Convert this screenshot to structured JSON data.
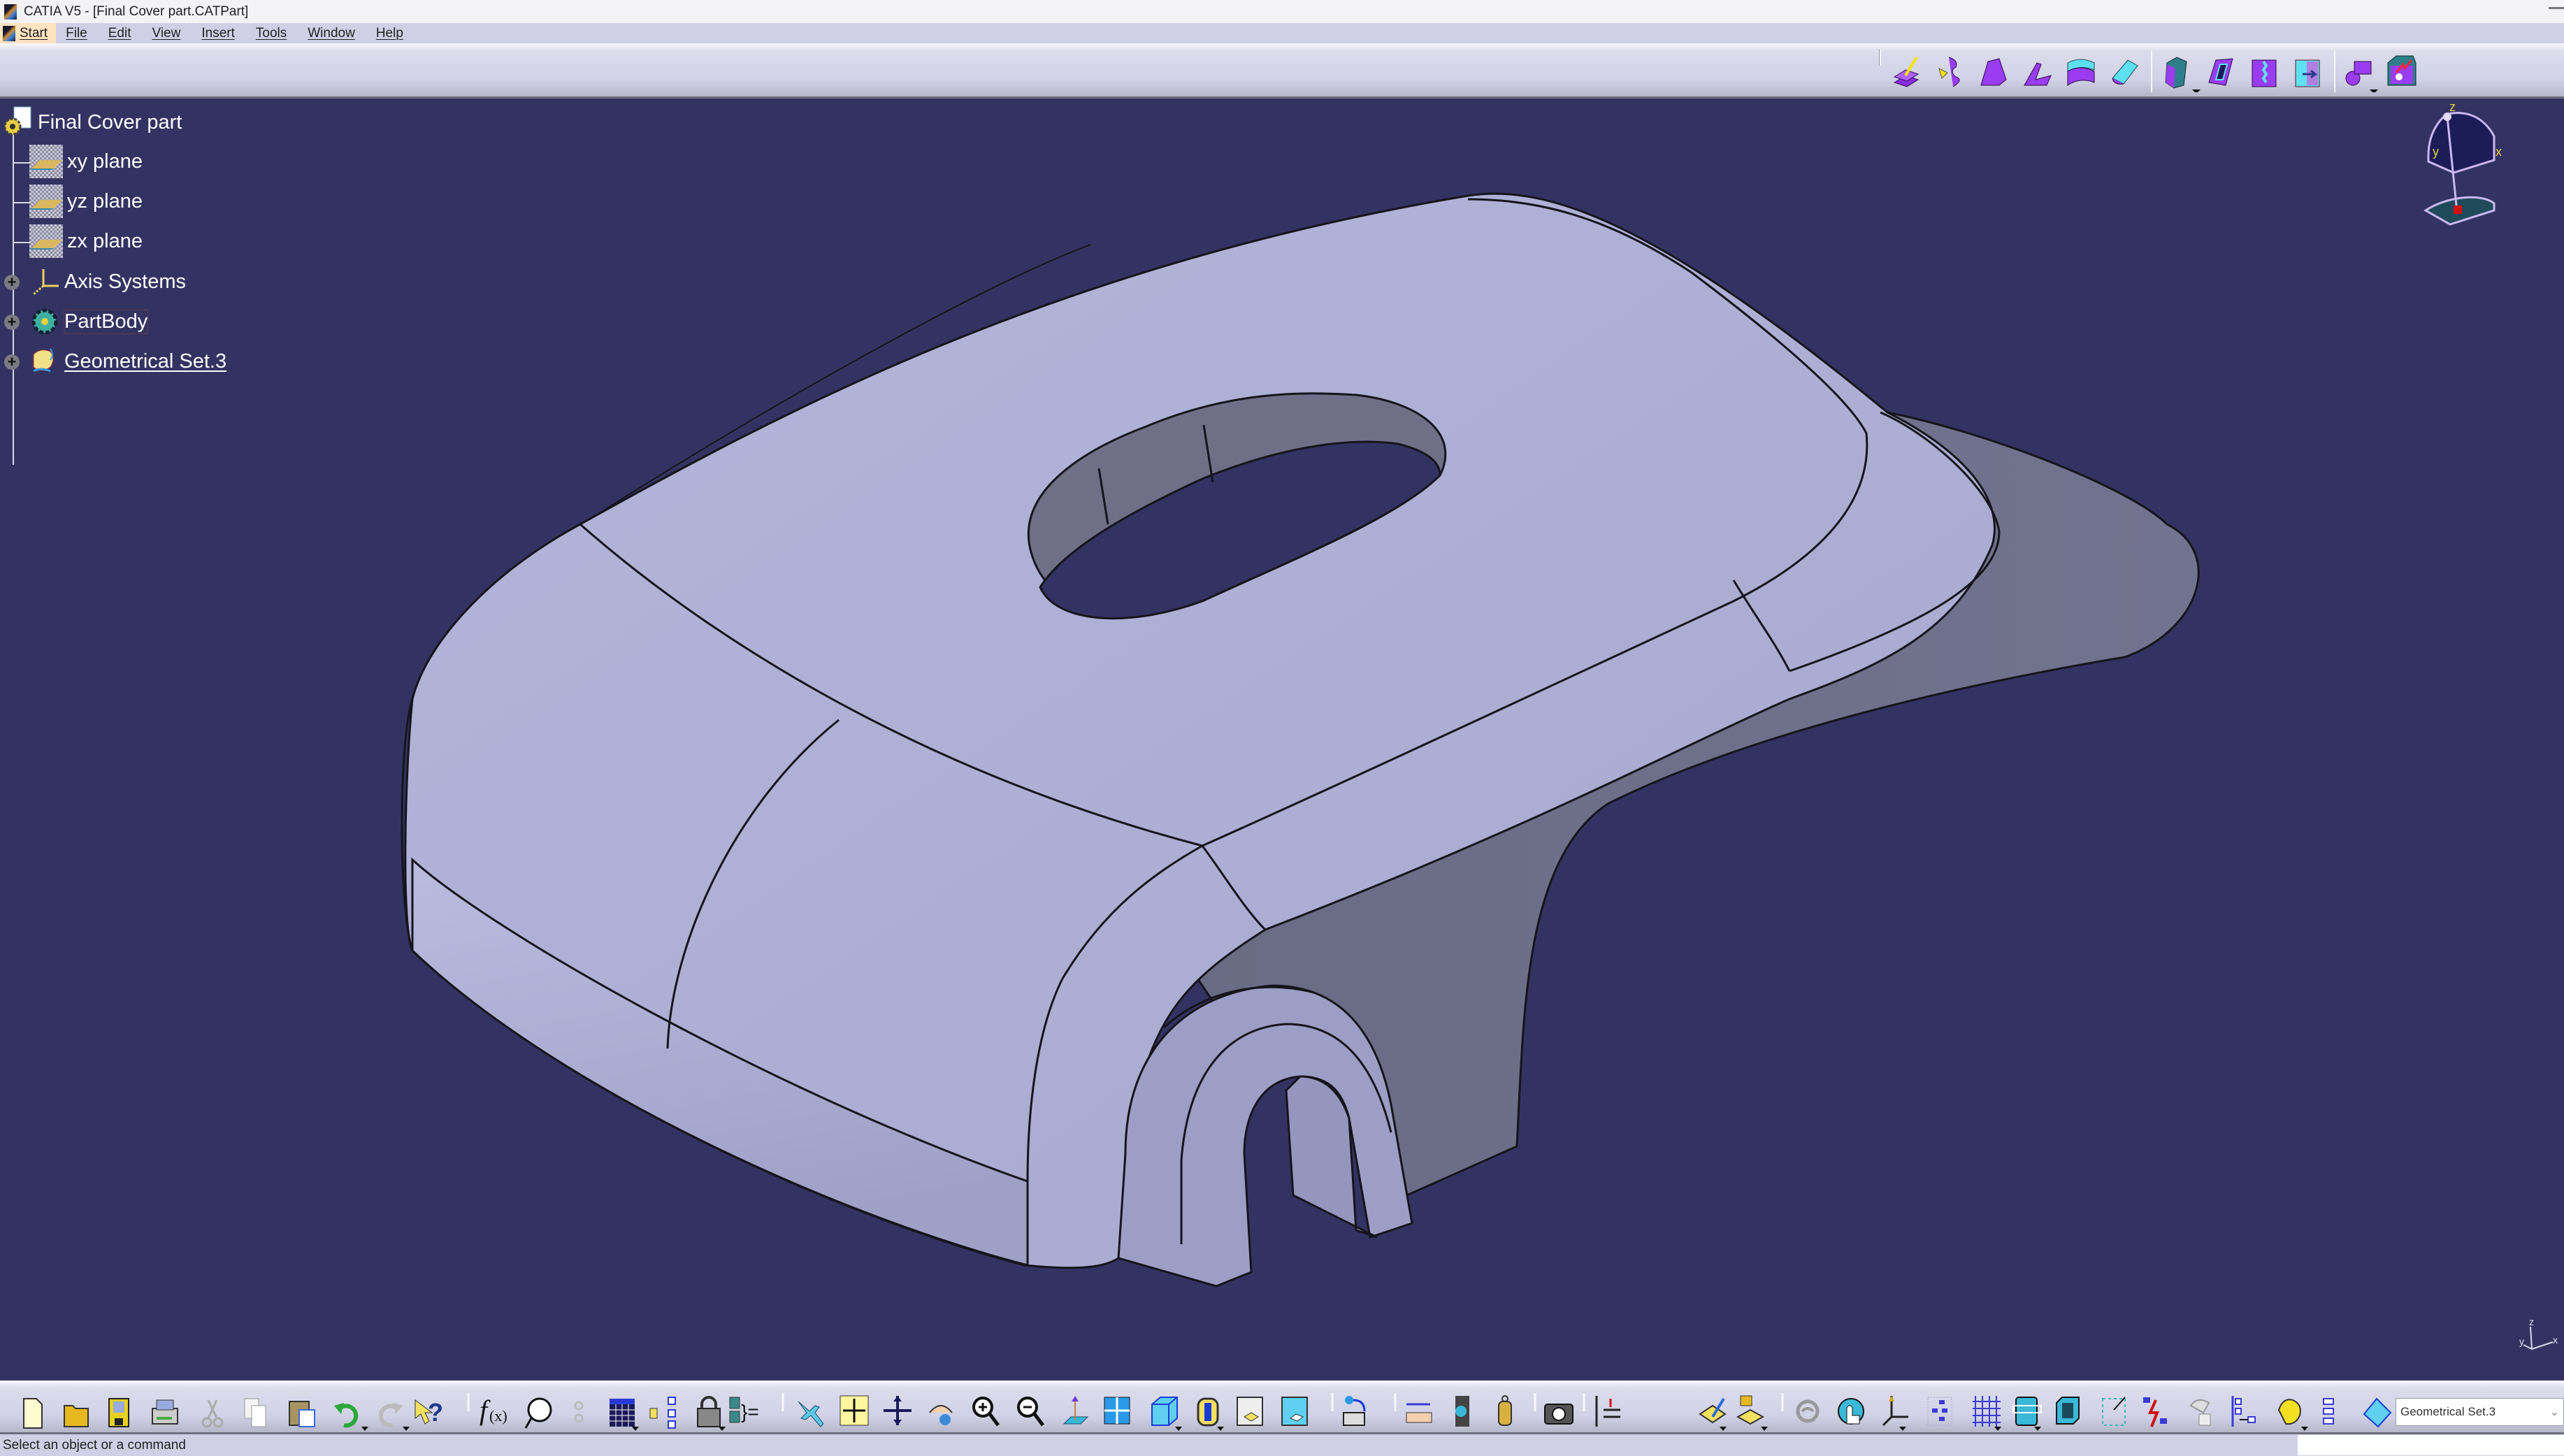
{
  "window": {
    "title": "CATIA V5 - [Final Cover part.CATPart]",
    "minimize_glyph": "—"
  },
  "menu": {
    "items": [
      "Start",
      "File",
      "Edit",
      "View",
      "Insert",
      "Tools",
      "Window",
      "Help"
    ]
  },
  "top_toolbar": {
    "groups": [
      {
        "name": "part-design-features",
        "icons": [
          "pad-icon",
          "multi-section-icon",
          "rib-icon",
          "stiffener-icon",
          "thick-surface-icon",
          "fillet-icon"
        ]
      },
      {
        "name": "dress-up",
        "icons": [
          "draft-icon",
          "shell-icon",
          "thickness-icon",
          "remove-face-icon"
        ]
      },
      {
        "name": "transform",
        "icons": [
          "transformation-icon",
          "split-body-icon"
        ]
      }
    ]
  },
  "tree": {
    "root": "Final Cover part",
    "children": [
      {
        "label": "xy plane",
        "icon": "plane-icon",
        "expandable": false
      },
      {
        "label": "yz plane",
        "icon": "plane-icon",
        "expandable": false
      },
      {
        "label": "zx plane",
        "icon": "plane-icon",
        "expandable": false
      },
      {
        "label": "Axis Systems",
        "icon": "axis-system-icon",
        "expandable": true
      },
      {
        "label": "PartBody",
        "icon": "part-body-icon",
        "expandable": true
      },
      {
        "label": "Geometrical Set.3",
        "icon": "geometrical-set-icon",
        "expandable": true,
        "underlined": true
      }
    ]
  },
  "compass": {
    "labels": {
      "x": "x",
      "y": "y",
      "z": "z"
    }
  },
  "triad": {
    "labels": {
      "x": "x",
      "y": "y",
      "z": "z"
    }
  },
  "bottom_toolbar": {
    "standard": [
      "new-icon",
      "open-icon",
      "save-icon",
      "print-icon",
      "cut-icon",
      "copy-icon",
      "paste-icon",
      "undo-icon",
      "redo-icon",
      "whats-this-icon"
    ],
    "knowledge": [
      "formula-icon",
      "knowledge-advisor-icon",
      "design-table-link-icon",
      "table-icon",
      "relations-icon",
      "lock-icon",
      "parameters-icon"
    ],
    "view": [
      "fly-mode-icon",
      "fit-all-icon",
      "pan-icon",
      "rotate-icon",
      "zoom-in-icon",
      "zoom-out-icon",
      "normal-view-icon",
      "multi-view-icon",
      "iso-view-icon",
      "shading-icon",
      "hide-show-icon",
      "swap-visible-icon"
    ],
    "misc": [
      "update-icon",
      "measure-between-icon",
      "measure-item-icon",
      "measure-inertia-icon",
      "capture-icon",
      "analysis-icon",
      "sketch-icon",
      "sketch-positioned-icon",
      "scan-icon",
      "manipulation-icon",
      "axis-system-icon",
      "point-repetition-icon",
      "grid-icon",
      "bounding-box-icon",
      "box-icon",
      "frame-icon",
      "break-icon",
      "publish-icon",
      "reorder-icon",
      "catalog-icon",
      "list-icon",
      "geometrical-set-icon"
    ],
    "current_set": "Geometrical Set.3"
  },
  "status_bar": {
    "message": "Select an object or a command"
  },
  "colors": {
    "background": "#333363",
    "part_surface": "#acaed3",
    "part_shadow": "#6c6d87",
    "edge": "#1a1a22",
    "menubar": "#cfd0e6"
  }
}
